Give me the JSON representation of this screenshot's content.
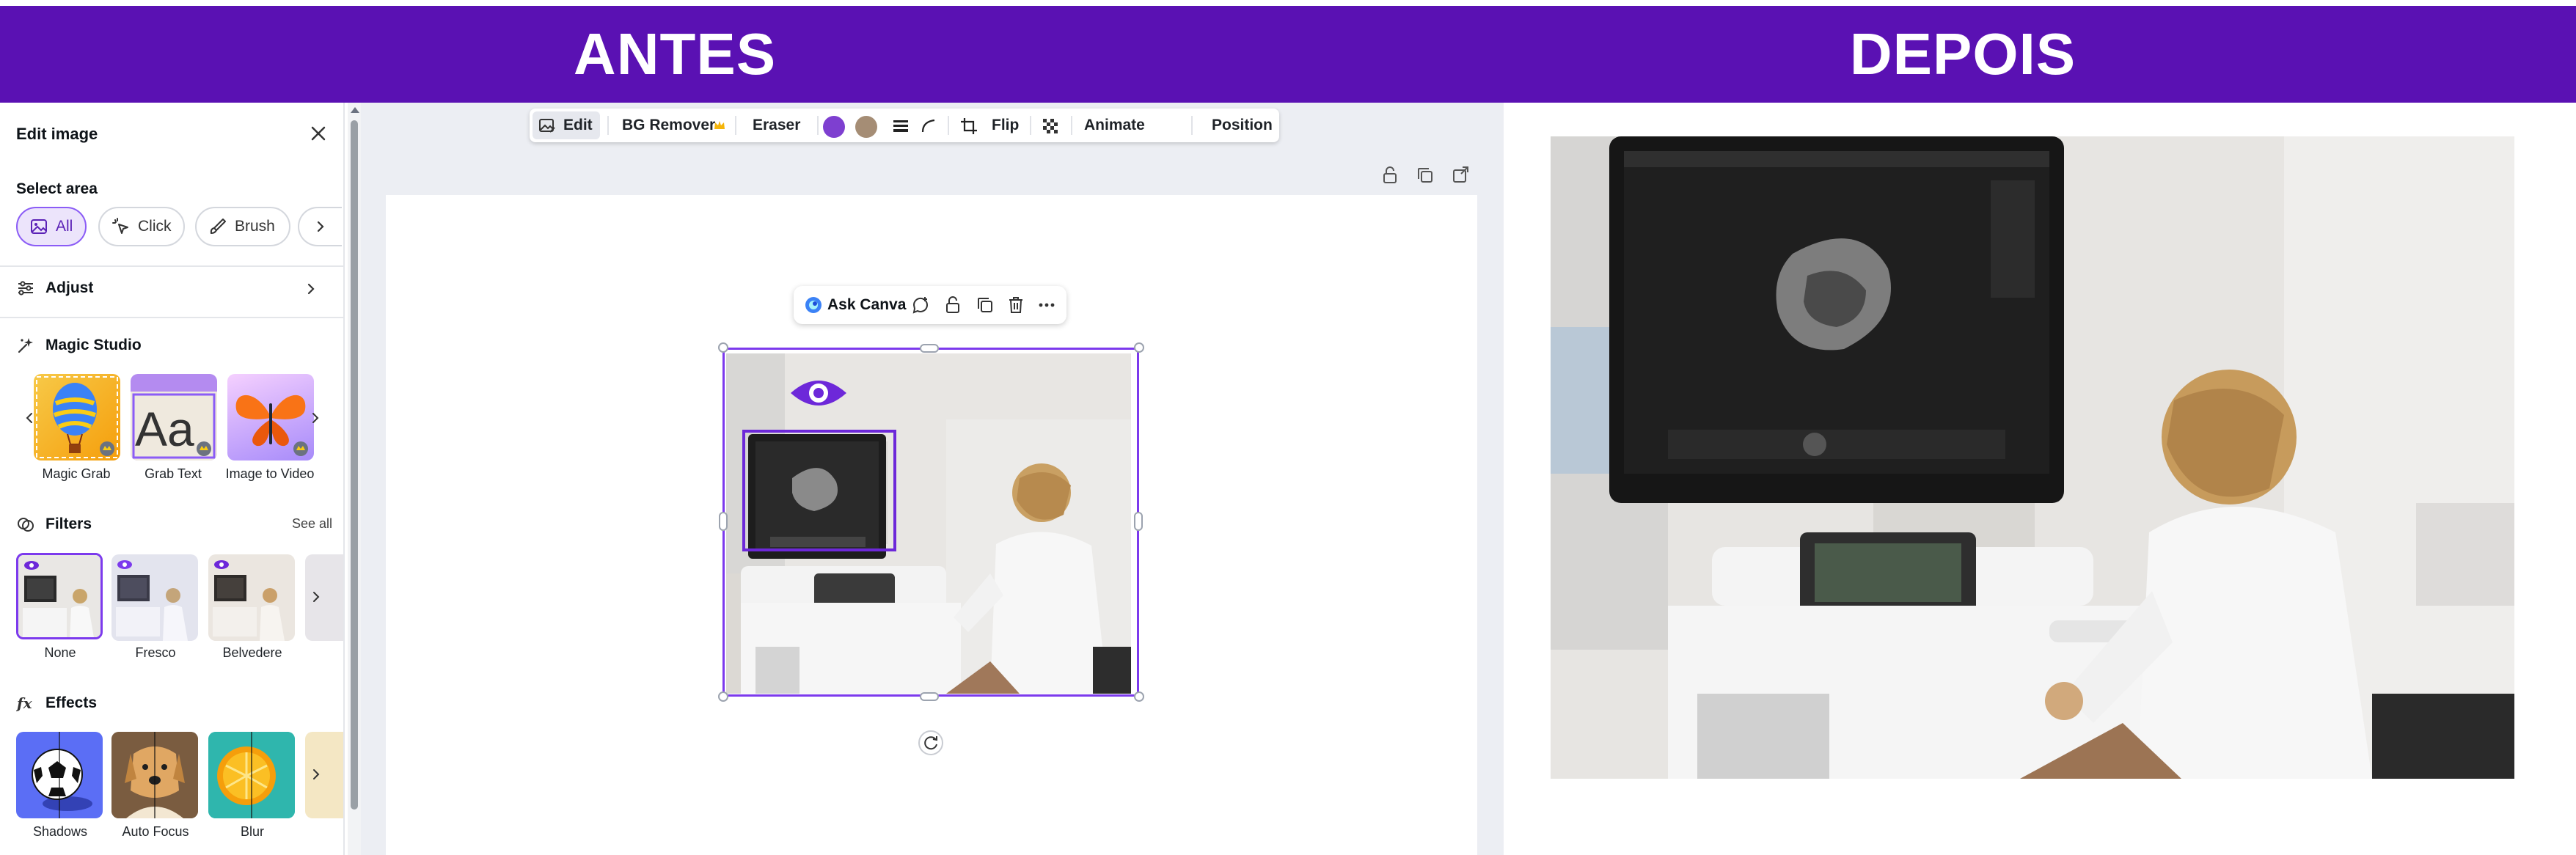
{
  "banner": {
    "left_title": "ANTES",
    "right_title": "DEPOIS",
    "color": "#5a11b3"
  },
  "panel": {
    "title": "Edit image",
    "select_area": {
      "label": "Select area",
      "options": [
        {
          "label": "All",
          "icon": "image-icon",
          "active": true
        },
        {
          "label": "Click",
          "icon": "magic-click-icon",
          "active": false
        },
        {
          "label": "Brush",
          "icon": "brush-icon",
          "active": false
        }
      ]
    },
    "adjust": {
      "label": "Adjust",
      "icon": "sliders-icon"
    },
    "magic_studio": {
      "label": "Magic Studio",
      "icon": "sparkle-icon",
      "items": [
        {
          "label": "Magic Grab"
        },
        {
          "label": "Grab Text"
        },
        {
          "label": "Image to Video"
        }
      ]
    },
    "filters": {
      "label": "Filters",
      "icon": "filter-icon",
      "see_all": "See all",
      "items": [
        {
          "label": "None"
        },
        {
          "label": "Fresco"
        },
        {
          "label": "Belvedere"
        }
      ]
    },
    "effects": {
      "label": "Effects",
      "icon": "fx-icon",
      "items": [
        {
          "label": "Shadows"
        },
        {
          "label": "Auto Focus"
        },
        {
          "label": "Blur"
        }
      ]
    }
  },
  "toolbar": {
    "edit": "Edit",
    "bg_remover": "BG Remover",
    "eraser": "Eraser",
    "color_1": "#7e3fd0",
    "color_2": "#a58d75",
    "flip": "Flip",
    "animate": "Animate",
    "position": "Position"
  },
  "float_bar": {
    "ask_canva": "Ask Canva"
  },
  "accent": "#7c3aed"
}
